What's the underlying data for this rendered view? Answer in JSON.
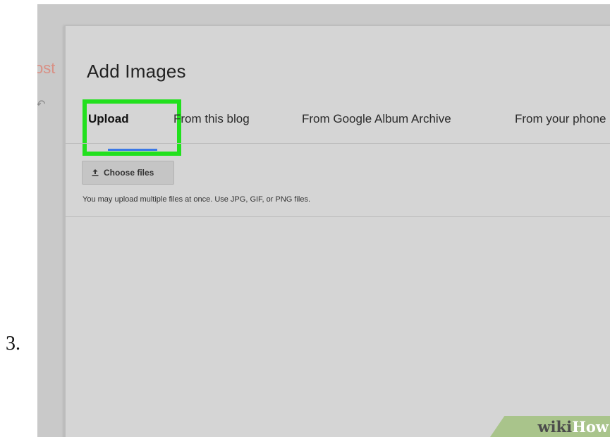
{
  "step_label": "3.",
  "background": {
    "post_text": "ost"
  },
  "dialog": {
    "title": "Add Images",
    "tabs": [
      {
        "label": "Upload",
        "active": true
      },
      {
        "label": "From this blog",
        "active": false
      },
      {
        "label": "From Google Album Archive",
        "active": false
      },
      {
        "label": "From your phone",
        "active": false
      }
    ],
    "choose_files_label": "Choose files",
    "hint": "You may upload multiple files at once. Use JPG, GIF, or PNG files."
  },
  "watermark": {
    "part1": "wiki",
    "part2": "How"
  },
  "colors": {
    "highlight": "#22e01e",
    "active_tab_underline": "#3b78e7",
    "dialog_background": "#d5d5d5",
    "watermark_background": "#a9c48b"
  }
}
